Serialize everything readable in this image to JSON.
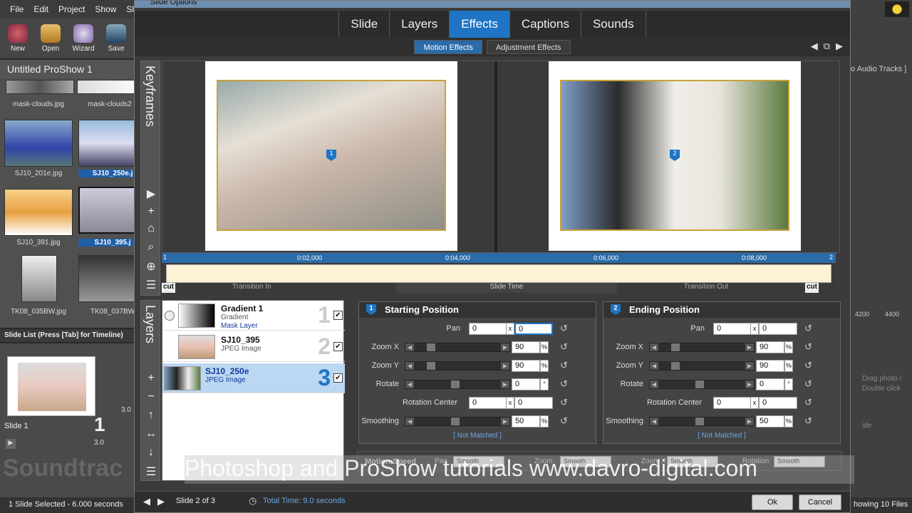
{
  "menu": [
    "File",
    "Edit",
    "Project",
    "Show",
    "Slid"
  ],
  "toolbar": [
    {
      "label": "New",
      "icon": "new-icon"
    },
    {
      "label": "Open",
      "icon": "open-icon"
    },
    {
      "label": "Wizard",
      "icon": "wizard-icon"
    },
    {
      "label": "Save",
      "icon": "save-icon"
    }
  ],
  "project_title": "Untitled ProShow 1",
  "files": [
    {
      "name": "mask-clouds.jpg"
    },
    {
      "name": "mask-clouds2"
    },
    {
      "name": "SJ10_201e.jpg"
    },
    {
      "name": "SJ10_250e.j"
    },
    {
      "name": "SJ10_391.jpg"
    },
    {
      "name": "SJ10_395.j"
    },
    {
      "name": "TK08_035BW.jpg"
    },
    {
      "name": "TK08_037BW"
    }
  ],
  "slide_list_header": "Slide List (Press [Tab] for Timeline)",
  "slide": {
    "label": "Slide 1",
    "number": "1",
    "duration": "3.0",
    "next_duration": "3.0"
  },
  "soundtrack_label": "Soundtrac",
  "status": {
    "left": "1 Slide Selected - 6.000 seconds",
    "right": "howing 10 Files"
  },
  "right_panel": {
    "audio": "o Audio Tracks ]",
    "t1": "4200",
    "t2": "4400",
    "hint1": "Drag photo /",
    "hint2": "Double click",
    "hint3": "ide"
  },
  "dialog": {
    "title": "Slide Options",
    "tabs": [
      "Slide",
      "Layers",
      "Effects",
      "Captions",
      "Sounds"
    ],
    "active_tab": "Effects",
    "subtabs": [
      "Motion Effects",
      "Adjustment Effects"
    ],
    "keyframes_label": "Keyframes",
    "layers_label": "Layers",
    "timeline": {
      "ticks": [
        "0:02,000",
        "0:04,000",
        "0:06,000",
        "0:08,000"
      ],
      "start_marker": "1",
      "end_marker": "2",
      "labels": [
        "Transition In",
        "Slide Time",
        "Transition Out"
      ],
      "cut": "cut"
    },
    "layers": [
      {
        "name": "Gradient 1",
        "type": "Gradient",
        "sub": "Mask Layer",
        "num": "1",
        "checked": "✔"
      },
      {
        "name": "SJ10_395",
        "type": "JPEG Image",
        "sub": "",
        "num": "2",
        "checked": "✔"
      },
      {
        "name": "SJ10_250e",
        "type": "JPEG Image",
        "sub": "",
        "num": "3",
        "checked": "✔"
      }
    ],
    "start": {
      "title": "Starting Position",
      "badge": "1",
      "pan_x": "0",
      "pan_y": "0",
      "zoom_x": "90",
      "zoom_y": "90",
      "rotate": "0",
      "rc_x": "0",
      "rc_y": "0",
      "smoothing": "50",
      "not_matched": "[ Not Matched ]"
    },
    "end": {
      "title": "Ending Position",
      "badge": "2",
      "pan_x": "0",
      "pan_y": "0",
      "zoom_x": "90",
      "zoom_y": "90",
      "rotate": "0",
      "rc_x": "0",
      "rc_y": "0",
      "smoothing": "50",
      "not_matched": "[ Not Matched ]"
    },
    "labels": {
      "pan": "Pan",
      "zoom_x": "Zoom X",
      "zoom_y": "Zoom Y",
      "rotate": "Rotate",
      "rotation_center": "Rotation Center",
      "smoothing": "Smoothing",
      "x": "x",
      "pct": "%",
      "deg": "°"
    },
    "motion_bar": {
      "title": "Motion Speed",
      "pan": "Pan",
      "zoom": "Zoom",
      "zoomx": "Zoom X",
      "rotation": "Rotation",
      "value": "Smooth"
    },
    "watermark": "Photoshop and ProShow tutorials www.davro-digital.com",
    "bottom": {
      "slide_of": "Slide 2 of 3",
      "total_time": "Total Time: 9.0 seconds",
      "ok": "Ok",
      "cancel": "Cancel"
    }
  }
}
